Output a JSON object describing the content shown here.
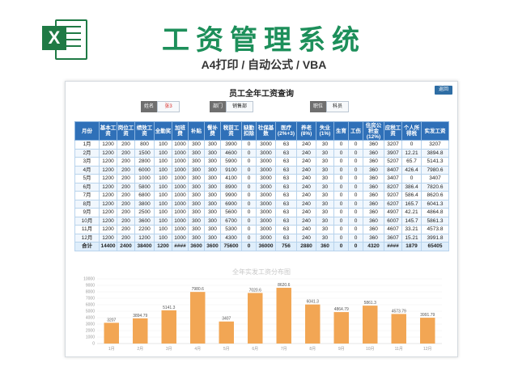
{
  "header": {
    "logo_letter": "X",
    "title": "工资管理系统",
    "subtitle": "A4打印 / 自动公式 / VBA"
  },
  "sheet": {
    "title": "员工全年工资查询",
    "return_label": "返回",
    "filters": [
      {
        "label": "姓名",
        "value": "张3",
        "value_color": "#d9302c"
      },
      {
        "label": "部门",
        "value": "销售部"
      },
      {
        "label": "职位",
        "value": "科员"
      }
    ]
  },
  "table": {
    "headers": [
      "月份",
      "基本工资",
      "岗位工资",
      "绩效工资",
      "全勤奖",
      "加班费",
      "补贴",
      "餐补费",
      "税前工资",
      "缺勤扣除",
      "社保基数",
      "医疗(2%+3)",
      "养老(8%)",
      "失业(1%)",
      "生育",
      "工伤",
      "住房公积金(12%)",
      "应税工资",
      "个人所得税",
      "实发工资"
    ],
    "rows": [
      [
        "1月",
        "1200",
        "200",
        "800",
        "100",
        "1000",
        "300",
        "300",
        "3900",
        "0",
        "3000",
        "63",
        "240",
        "30",
        "0",
        "0",
        "360",
        "3207",
        "0",
        "3207"
      ],
      [
        "2月",
        "1200",
        "200",
        "1500",
        "100",
        "1000",
        "300",
        "300",
        "4600",
        "0",
        "3000",
        "63",
        "240",
        "30",
        "0",
        "0",
        "360",
        "3907",
        "12.21",
        "3894.8"
      ],
      [
        "3月",
        "1200",
        "200",
        "2800",
        "100",
        "1000",
        "300",
        "300",
        "5900",
        "0",
        "3000",
        "63",
        "240",
        "30",
        "0",
        "0",
        "360",
        "5207",
        "65.7",
        "5141.3"
      ],
      [
        "4月",
        "1200",
        "200",
        "6000",
        "100",
        "1000",
        "300",
        "300",
        "9100",
        "0",
        "3000",
        "63",
        "240",
        "30",
        "0",
        "0",
        "360",
        "8407",
        "426.4",
        "7980.6"
      ],
      [
        "5月",
        "1200",
        "200",
        "1000",
        "100",
        "1000",
        "300",
        "300",
        "4100",
        "0",
        "3000",
        "63",
        "240",
        "30",
        "0",
        "0",
        "360",
        "3407",
        "0",
        "3407"
      ],
      [
        "6月",
        "1200",
        "200",
        "5800",
        "100",
        "1000",
        "300",
        "300",
        "8900",
        "0",
        "3000",
        "63",
        "240",
        "30",
        "0",
        "0",
        "360",
        "8207",
        "386.4",
        "7820.6"
      ],
      [
        "7月",
        "1200",
        "200",
        "6800",
        "100",
        "1000",
        "300",
        "300",
        "9900",
        "0",
        "3000",
        "63",
        "240",
        "30",
        "0",
        "0",
        "360",
        "9207",
        "586.4",
        "8620.6"
      ],
      [
        "8月",
        "1200",
        "200",
        "3800",
        "100",
        "1000",
        "300",
        "300",
        "6900",
        "0",
        "3000",
        "63",
        "240",
        "30",
        "0",
        "0",
        "360",
        "6207",
        "165.7",
        "6041.3"
      ],
      [
        "9月",
        "1200",
        "200",
        "2500",
        "100",
        "1000",
        "300",
        "300",
        "5600",
        "0",
        "3000",
        "63",
        "240",
        "30",
        "0",
        "0",
        "360",
        "4907",
        "42.21",
        "4864.8"
      ],
      [
        "10月",
        "1200",
        "200",
        "3600",
        "100",
        "1000",
        "300",
        "300",
        "6700",
        "0",
        "3000",
        "63",
        "240",
        "30",
        "0",
        "0",
        "360",
        "6007",
        "145.7",
        "5861.3"
      ],
      [
        "11月",
        "1200",
        "200",
        "2200",
        "100",
        "1000",
        "300",
        "300",
        "5300",
        "0",
        "3000",
        "63",
        "240",
        "30",
        "0",
        "0",
        "360",
        "4607",
        "33.21",
        "4573.8"
      ],
      [
        "12月",
        "1200",
        "200",
        "1200",
        "100",
        "1000",
        "300",
        "300",
        "4300",
        "0",
        "3000",
        "63",
        "240",
        "30",
        "0",
        "0",
        "360",
        "3607",
        "15.21",
        "3991.8"
      ]
    ],
    "total": [
      "合计",
      "14400",
      "2400",
      "38400",
      "1200",
      "####",
      "3600",
      "3600",
      "75600",
      "0",
      "36000",
      "756",
      "2880",
      "360",
      "0",
      "0",
      "4320",
      "####",
      "1879",
      "65405"
    ]
  },
  "chart_data": {
    "type": "bar",
    "title": "全年实发工资分布图",
    "categories": [
      "1月",
      "2月",
      "3月",
      "4月",
      "5月",
      "6月",
      "7月",
      "8月",
      "9月",
      "10月",
      "11月",
      "12月"
    ],
    "values": [
      3207,
      3894.79,
      5141.3,
      7980.6,
      3407,
      7820.6,
      8620.6,
      6041.3,
      4864.79,
      5861.3,
      4573.79,
      3991.79
    ],
    "value_labels": [
      "3207",
      "3894.79",
      "5141.3",
      "7980.6",
      "3407",
      "7020.6",
      "8620.6",
      "6041.3",
      "4864.79",
      "5861.3",
      "4573.79",
      "3991.79"
    ],
    "ylim": [
      0,
      10000
    ],
    "yticks": [
      "0",
      "1000",
      "2000",
      "3000",
      "4000",
      "5000",
      "6000",
      "7000",
      "8000",
      "9000",
      "10000"
    ],
    "bar_color": "#f2a654",
    "grid": true
  }
}
